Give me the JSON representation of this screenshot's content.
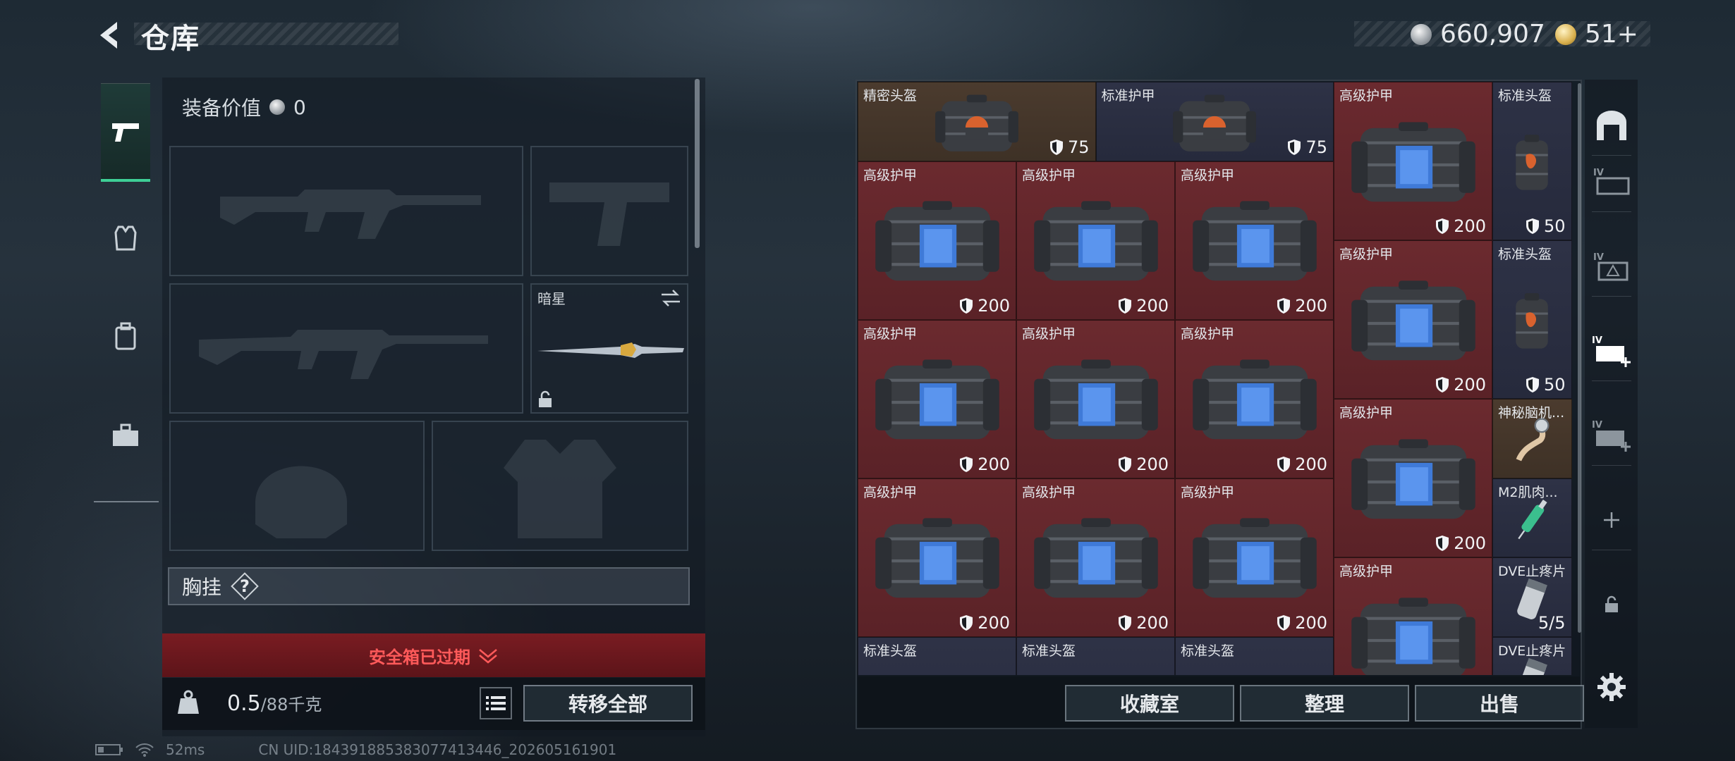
{
  "header": {
    "title": "仓库",
    "currency_silver": "660,907",
    "currency_gold": "51+"
  },
  "equipment": {
    "value_label": "装备价值",
    "value": "0",
    "knife_name": "暗星",
    "chest_label": "胸挂",
    "help_mark": "?",
    "safebox_expired": "安全箱已过期",
    "weight_current": "0.5",
    "weight_max": "/88千克",
    "transfer_all": "转移全部"
  },
  "warehouse": {
    "items": [
      {
        "name": "精密头盔",
        "value": "75",
        "color": "brown",
        "type": "helmet-bag"
      },
      {
        "name": "标准护甲",
        "value": "75",
        "color": "blue",
        "type": "helmet-bag"
      },
      {
        "name": "高级护甲",
        "value": "200",
        "color": "red",
        "type": "armor"
      },
      {
        "name": "标准头盔",
        "value": "50",
        "color": "blue",
        "type": "helmet-small"
      },
      {
        "name": "高级护甲",
        "value": "200",
        "color": "red",
        "type": "armor"
      },
      {
        "name": "高级护甲",
        "value": "200",
        "color": "red",
        "type": "armor"
      },
      {
        "name": "高级护甲",
        "value": "200",
        "color": "red",
        "type": "armor"
      },
      {
        "name": "高级护甲",
        "value": "200",
        "color": "red",
        "type": "armor"
      },
      {
        "name": "标准头盔",
        "value": "50",
        "color": "blue",
        "type": "helmet-small"
      },
      {
        "name": "高级护甲",
        "value": "200",
        "color": "red",
        "type": "armor"
      },
      {
        "name": "高级护甲",
        "value": "200",
        "color": "red",
        "type": "armor"
      },
      {
        "name": "高级护甲",
        "value": "200",
        "color": "red",
        "type": "armor"
      },
      {
        "name": "高级护甲",
        "value": "200",
        "color": "red",
        "type": "armor"
      },
      {
        "name": "神秘脑机...",
        "value": "",
        "color": "brown",
        "type": "brain"
      },
      {
        "name": "高级护甲",
        "value": "200",
        "color": "red",
        "type": "armor"
      },
      {
        "name": "高级护甲",
        "value": "200",
        "color": "red",
        "type": "armor"
      },
      {
        "name": "高级护甲",
        "value": "200",
        "color": "red",
        "type": "armor"
      },
      {
        "name": "M2肌肉...",
        "value": "",
        "color": "blue",
        "type": "syringe"
      },
      {
        "name": "高级护甲",
        "value": "200",
        "color": "red",
        "type": "armor"
      },
      {
        "name": "DVE止疼片",
        "value": "5/5",
        "color": "blue",
        "type": "pills"
      },
      {
        "name": "标准头盔",
        "value": "",
        "color": "blue",
        "type": "helmet-bag"
      },
      {
        "name": "标准头盔",
        "value": "",
        "color": "blue",
        "type": "helmet-bag"
      },
      {
        "name": "标准头盔",
        "value": "",
        "color": "blue",
        "type": "helmet-bag"
      },
      {
        "name": "DVE止疼片",
        "value": "",
        "color": "blue",
        "type": "pills"
      }
    ],
    "buttons": {
      "collection": "收藏室",
      "organize": "整理",
      "sell": "出售"
    }
  },
  "status": {
    "ping": "52ms",
    "uid": "CN UID:1843918853830774134​46_202605161901"
  },
  "colors": {
    "accent_green": "#3ecf96",
    "expired_red": "#ff5a5a"
  }
}
